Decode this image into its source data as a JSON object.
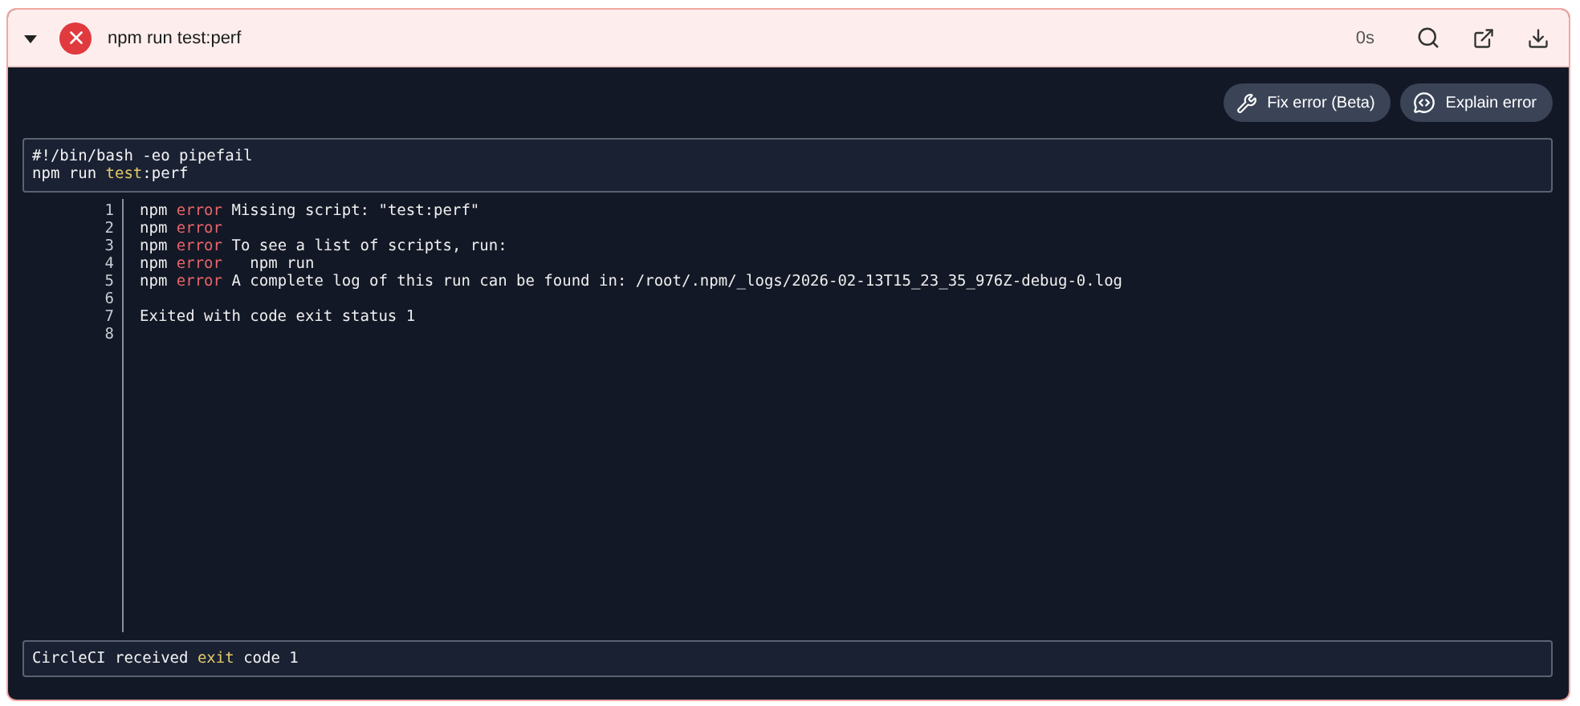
{
  "step": {
    "expanded": true,
    "failed": true,
    "title": "npm run test:perf",
    "duration": "0s"
  },
  "actions": [
    {
      "kind": "fix",
      "label": "Fix error (Beta)"
    },
    {
      "kind": "explain",
      "label": "Explain error"
    }
  ],
  "script": [
    [
      {
        "kind": "plain",
        "text": "#!/bin/bash -eo pipefail"
      }
    ],
    [
      {
        "kind": "plain",
        "text": "npm run "
      },
      {
        "kind": "keyword",
        "text": "test"
      },
      {
        "kind": "plain",
        "text": ":perf"
      }
    ]
  ],
  "log": [
    {
      "number": "1",
      "segments": [
        {
          "kind": "plain",
          "text": "npm "
        },
        {
          "kind": "error",
          "text": "error"
        },
        {
          "kind": "plain",
          "text": " Missing script: \"test:perf\""
        }
      ]
    },
    {
      "number": "2",
      "segments": [
        {
          "kind": "plain",
          "text": "npm "
        },
        {
          "kind": "error",
          "text": "error"
        }
      ]
    },
    {
      "number": "3",
      "segments": [
        {
          "kind": "plain",
          "text": "npm "
        },
        {
          "kind": "error",
          "text": "error"
        },
        {
          "kind": "plain",
          "text": " To see a list of scripts, run:"
        }
      ]
    },
    {
      "number": "4",
      "segments": [
        {
          "kind": "plain",
          "text": "npm "
        },
        {
          "kind": "error",
          "text": "error"
        },
        {
          "kind": "plain",
          "text": "   npm run"
        }
      ]
    },
    {
      "number": "5",
      "segments": [
        {
          "kind": "plain",
          "text": "npm "
        },
        {
          "kind": "error",
          "text": "error"
        },
        {
          "kind": "plain",
          "text": " A complete log of this run can be found in: /root/.npm/_logs/2026-02-13T15_23_35_976Z-debug-0.log"
        }
      ]
    },
    {
      "number": "6"
    },
    {
      "number": "7",
      "segments": [
        {
          "kind": "plain",
          "text": "Exited with code exit status 1"
        }
      ]
    },
    {
      "number": "8"
    }
  ],
  "footer": [
    {
      "kind": "plain",
      "text": "CircleCI received "
    },
    {
      "kind": "keyword",
      "text": "exit"
    },
    {
      "kind": "plain",
      "text": " code 1"
    }
  ]
}
